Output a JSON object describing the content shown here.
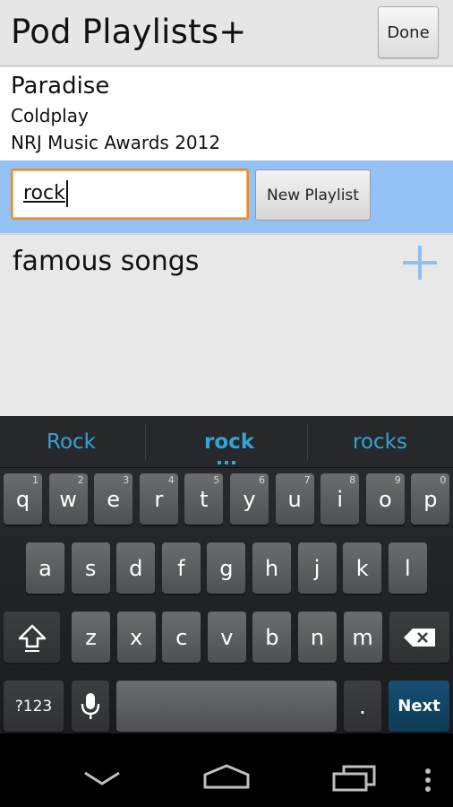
{
  "header": {
    "title": "Pod Playlists+",
    "done_label": "Done"
  },
  "song": {
    "title": "Paradise",
    "artist": "Coldplay",
    "album": "NRJ Music Awards 2012"
  },
  "new_playlist": {
    "input_value": "rock",
    "button_label": "New Playlist"
  },
  "playlists": [
    {
      "name": "famous songs"
    }
  ],
  "suggestions": [
    "Rock",
    "rock",
    "rocks"
  ],
  "keyboard": {
    "row1": [
      {
        "k": "q",
        "h": "1"
      },
      {
        "k": "w",
        "h": "2"
      },
      {
        "k": "e",
        "h": "3"
      },
      {
        "k": "r",
        "h": "4"
      },
      {
        "k": "t",
        "h": "5"
      },
      {
        "k": "y",
        "h": "6"
      },
      {
        "k": "u",
        "h": "7"
      },
      {
        "k": "i",
        "h": "8"
      },
      {
        "k": "o",
        "h": "9"
      },
      {
        "k": "p",
        "h": "0"
      }
    ],
    "row2": [
      "a",
      "s",
      "d",
      "f",
      "g",
      "h",
      "j",
      "k",
      "l"
    ],
    "row3": [
      "z",
      "x",
      "c",
      "v",
      "b",
      "n",
      "m"
    ],
    "symbols_label": "?123",
    "period_label": ".",
    "next_label": "Next"
  },
  "colors": {
    "accent": "#33a5d6",
    "selection_row": "#94c2f6",
    "input_focus": "#f08a1c",
    "next_key": "#164e72"
  }
}
